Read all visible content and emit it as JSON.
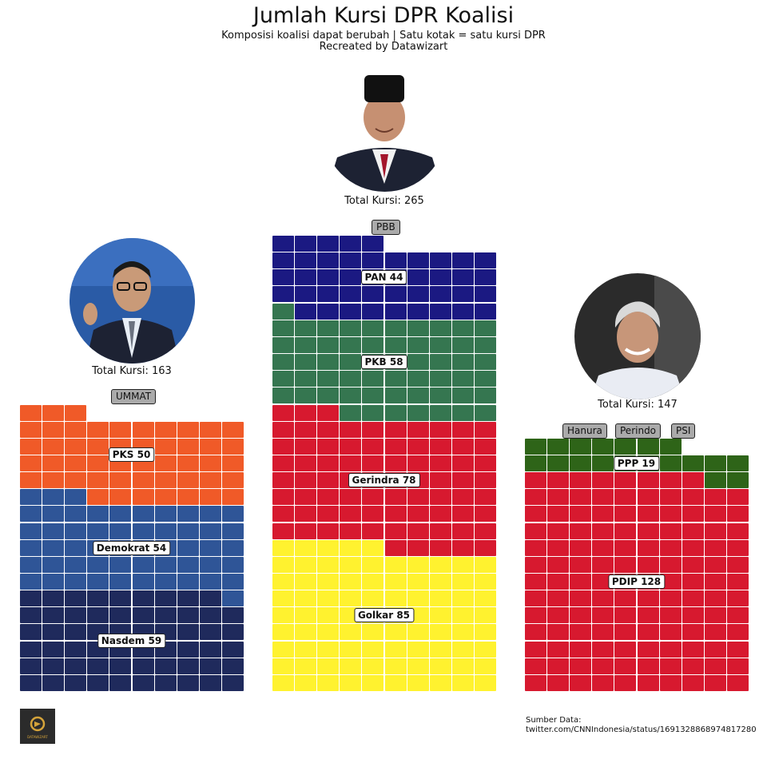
{
  "title": "Jumlah Kursi DPR Koalisi",
  "subtitle_line1": "Komposisi koalisi dapat berubah | Satu kotak = satu kursi DPR",
  "subtitle_line2": "Recreated by Datawizart",
  "source_line1": "Sumber Data:",
  "source_line2": "twitter.com/CNNIndonesia/status/1691328868974817280",
  "logo_text": "DATAWIZART",
  "chart_data": {
    "type": "waffle",
    "unit": "Satu kotak = satu kursi DPR",
    "columns_per_block": 10,
    "coalitions": [
      {
        "id": "left",
        "total_label": "Total Kursi: 163",
        "total": 163,
        "zero_seat_parties": [
          "UMMAT"
        ],
        "parties": [
          {
            "name": "Nasdem",
            "seats": 59,
            "color": "#1f2a5c",
            "label": "Nasdem 59"
          },
          {
            "name": "Demokrat",
            "seats": 54,
            "color": "#2f5597",
            "label": "Demokrat 54"
          },
          {
            "name": "PKS",
            "seats": 50,
            "color": "#f05a28",
            "label": "PKS 50"
          }
        ]
      },
      {
        "id": "center",
        "total_label": "Total Kursi: 265",
        "total": 265,
        "zero_seat_parties": [
          "PBB"
        ],
        "parties": [
          {
            "name": "Golkar",
            "seats": 85,
            "color": "#fff22f",
            "label": "Golkar 85"
          },
          {
            "name": "Gerindra",
            "seats": 78,
            "color": "#d7192f",
            "label": "Gerindra 78"
          },
          {
            "name": "PKB",
            "seats": 58,
            "color": "#357650",
            "label": "PKB 58"
          },
          {
            "name": "PAN",
            "seats": 44,
            "color": "#1b1982",
            "label": "PAN 44"
          }
        ]
      },
      {
        "id": "right",
        "total_label": "Total Kursi: 147",
        "total": 147,
        "zero_seat_parties": [
          "Hanura",
          "Perindo",
          "PSI"
        ],
        "parties": [
          {
            "name": "PDIP",
            "seats": 128,
            "color": "#d7192f",
            "label": "PDIP 128"
          },
          {
            "name": "PPP",
            "seats": 19,
            "color": "#2e6418",
            "label": "PPP 19"
          }
        ]
      }
    ]
  }
}
